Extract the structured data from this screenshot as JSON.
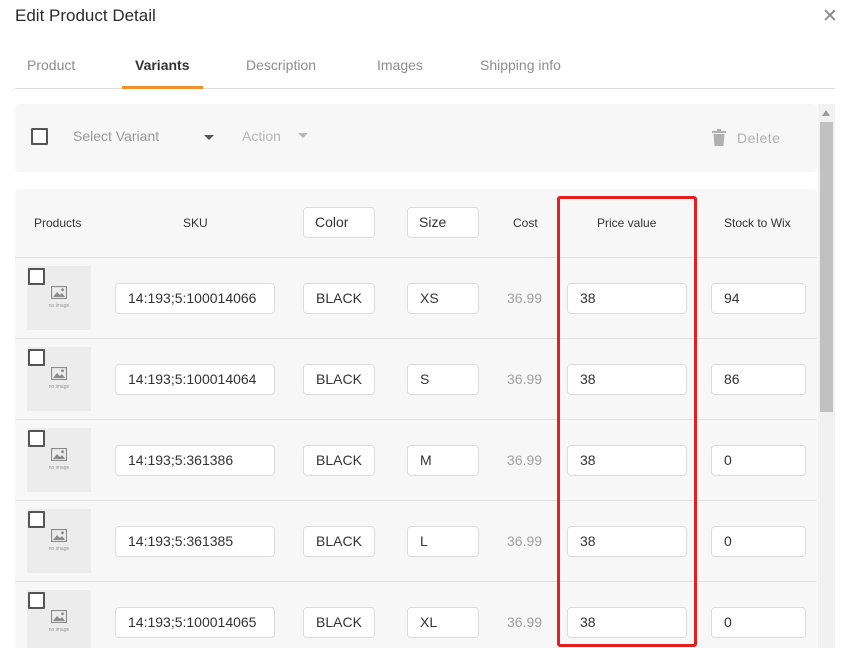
{
  "dialog": {
    "title": "Edit Product Detail"
  },
  "tabs": [
    {
      "label": "Product"
    },
    {
      "label": "Variants"
    },
    {
      "label": "Description"
    },
    {
      "label": "Images"
    },
    {
      "label": "Shipping info"
    }
  ],
  "active_tab": "Variants",
  "toolbar": {
    "select_variant": "Select Variant",
    "action": "Action",
    "delete": "Delete"
  },
  "table": {
    "headers": {
      "products": "Products",
      "sku": "SKU",
      "color": "Color",
      "size": "Size",
      "cost": "Cost",
      "price": "Price value",
      "stock": "Stock to Wix"
    },
    "no_image_label": "no image",
    "rows": [
      {
        "sku": "14:193;5:100014066",
        "color": "BLACK",
        "size": "XS",
        "cost": "36.99",
        "price": "38",
        "stock": "94"
      },
      {
        "sku": "14:193;5:100014064",
        "color": "BLACK",
        "size": "S",
        "cost": "36.99",
        "price": "38",
        "stock": "86"
      },
      {
        "sku": "14:193;5:361386",
        "color": "BLACK",
        "size": "M",
        "cost": "36.99",
        "price": "38",
        "stock": "0"
      },
      {
        "sku": "14:193;5:361385",
        "color": "BLACK",
        "size": "L",
        "cost": "36.99",
        "price": "38",
        "stock": "0"
      },
      {
        "sku": "14:193;5:100014065",
        "color": "BLACK",
        "size": "XL",
        "cost": "36.99",
        "price": "38",
        "stock": "0"
      }
    ]
  },
  "colors": {
    "accent": "#f0932b",
    "highlight": "#e51e1e"
  },
  "icons": {
    "close": "close-icon",
    "caret": "chevron-down-icon",
    "delete": "trash-icon",
    "placeholder": "image-placeholder-icon"
  }
}
